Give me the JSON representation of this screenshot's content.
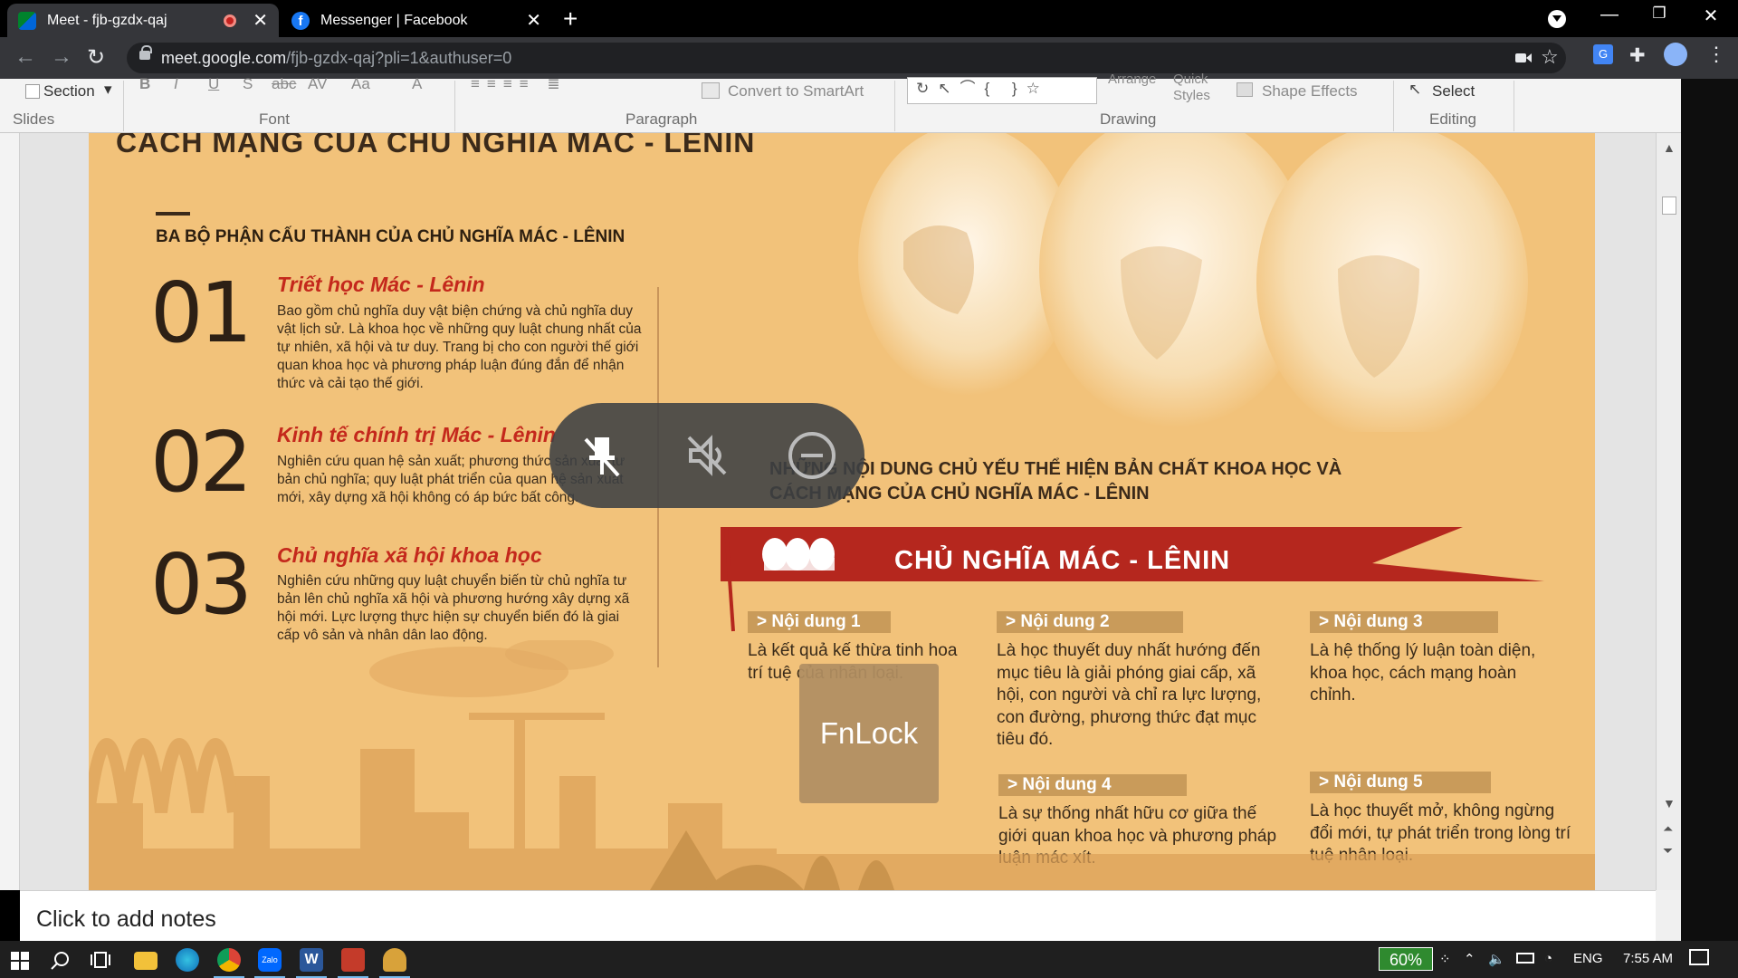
{
  "browser": {
    "tabs": [
      {
        "title": "Meet - fjb-gzdx-qaj",
        "active": true,
        "recording": true
      },
      {
        "title": "Messenger | Facebook",
        "active": false
      }
    ],
    "url_host": "meet.google.com",
    "url_rest": "/fjb-gzdx-qaj?pli=1&authuser=0",
    "new_tab_label": "+"
  },
  "ribbon": {
    "section_label": "Section",
    "convert_label": "Convert to SmartArt",
    "arrange_label": "Arrange",
    "quick_styles_label": "Quick Styles",
    "shape_effects_label": "Shape Effects",
    "select_label": "Select",
    "font_format_glyphs": [
      "B",
      "I",
      "U",
      "S",
      "abc",
      "AV",
      "Aa",
      "A"
    ],
    "groups": [
      "Slides",
      "Font",
      "Paragraph",
      "Drawing",
      "Editing"
    ]
  },
  "slide": {
    "top_heading": "CÁCH MẠNG CỦA CHỦ NGHĨA MÁC - LÊNIN",
    "subheading": "BA BỘ PHẬN CẤU THÀNH CỦA CHỦ NGHĨA MÁC - LÊNIN",
    "items": [
      {
        "num": "01",
        "title": "Triết học Mác - Lênin",
        "body": "Bao gồm chủ nghĩa duy vật biện chứng và chủ nghĩa duy vật lịch sử. Là khoa học về những quy luật chung nhất của tự nhiên, xã hội và tư duy. Trang bị cho con người thế giới quan khoa học và phương pháp luận đúng đắn để nhận thức và cải tạo thế giới."
      },
      {
        "num": "02",
        "title": "Kinh tế chính trị Mác - Lênin",
        "body": "Nghiên cứu quan hệ sản xuất; phương thức sản xuất tư bản chủ nghĩa; quy luật phát triển của quan hệ sản xuất mới, xây dựng xã hội không có áp bức bất công."
      },
      {
        "num": "03",
        "title": "Chủ nghĩa xã hội khoa học",
        "body": "Nghiên cứu những quy luật chuyển biến từ chủ nghĩa tư bản lên chủ nghĩa xã hội và phương hướng xây dựng xã hội mới. Lực lượng thực hiện sự chuyển biến đó là giai cấp vô sản và nhân dân lao động."
      }
    ],
    "right_heading_line1": "NHỮNG NỘI DUNG CHỦ YẾU THỂ HIỆN BẢN CHẤT KHOA HỌC VÀ",
    "right_heading_line2": "CÁCH MẠNG CỦA CHỦ NGHĨA MÁC - LÊNIN",
    "banner_title": "CHỦ NGHĨA MÁC - LÊNIN",
    "contents": [
      {
        "tag": "> Nội dung 1",
        "body": "Là kết quả kế thừa tinh hoa trí tuệ của nhân loại."
      },
      {
        "tag": "> Nội dung 2",
        "body": "Là học thuyết duy nhất hướng đến mục tiêu là giải phóng giai cấp, xã hội, con người và chỉ ra lực lượng, con đường, phương thức đạt mục tiêu đó."
      },
      {
        "tag": "> Nội dung 3",
        "body": "Là hệ thống lý luận toàn diện, khoa học, cách mạng hoàn chỉnh."
      },
      {
        "tag": "> Nội dung 4",
        "body": "Là sự thống nhất hữu cơ giữa thế giới quan khoa học và phương pháp luận mác xít."
      },
      {
        "tag": "> Nội dung 5",
        "body": "Là học thuyết mở, không ngừng đổi mới, tự phát triển trong lòng trí tuệ nhân loại."
      }
    ]
  },
  "notes_placeholder": "Click to add notes",
  "toast": "FnLock",
  "taskbar": {
    "battery": "60%",
    "language": "ENG",
    "time": "7:55 AM"
  },
  "colors": {
    "slide_bg": "#f2c27a",
    "accent_red": "#b5271e",
    "tag_bg": "#c99b5a"
  }
}
